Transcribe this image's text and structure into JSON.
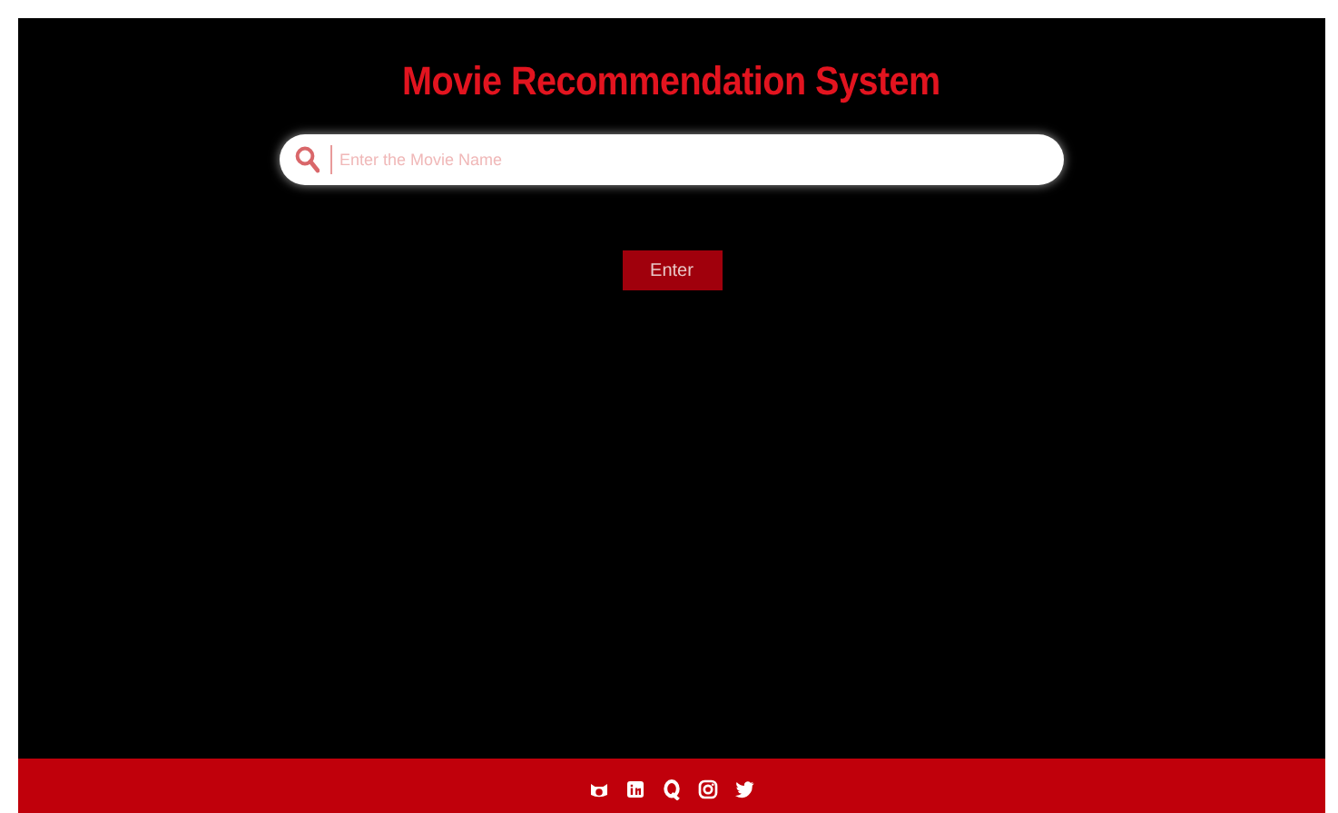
{
  "title": "Movie Recommendation System",
  "search": {
    "placeholder": "Enter the Movie Name"
  },
  "button": "Enter",
  "footer": {
    "icons": [
      {
        "kind": "cat"
      },
      {
        "kind": "square"
      },
      {
        "kind": "q"
      },
      {
        "kind": "camera"
      },
      {
        "kind": "bird"
      }
    ]
  }
}
